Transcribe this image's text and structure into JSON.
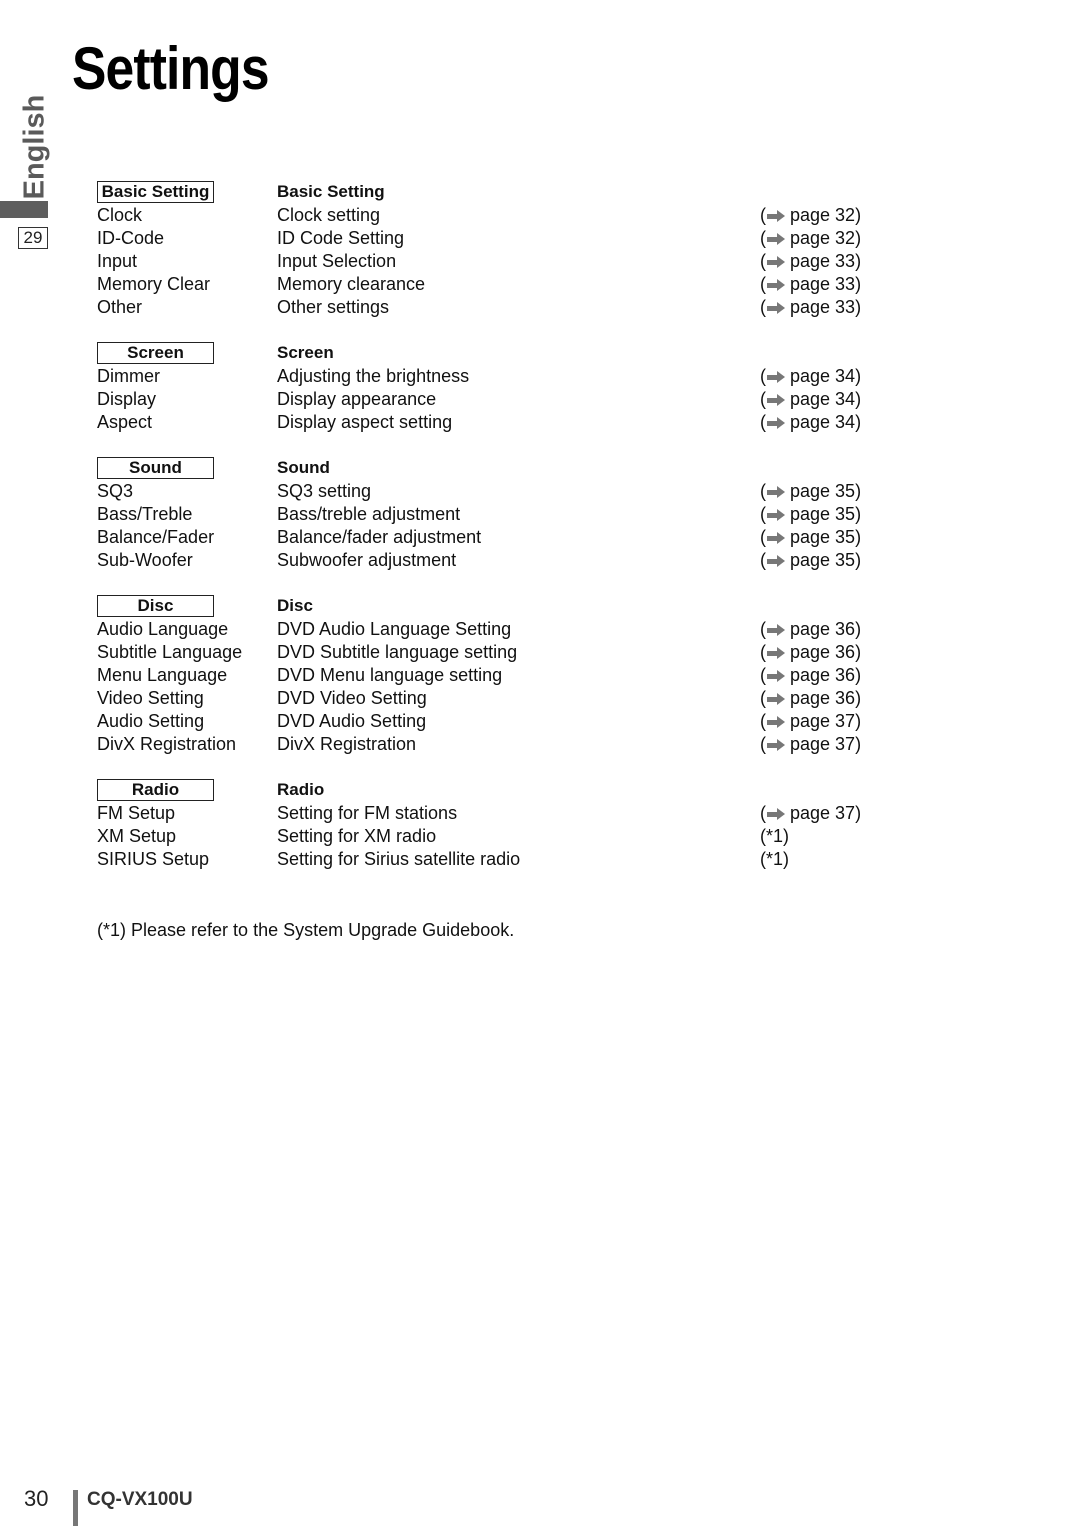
{
  "page": {
    "title": "Settings",
    "language_tab": "English",
    "section_page_number": "29",
    "page_number": "30",
    "model": "CQ-VX100U",
    "footnote": "(*1) Please refer to the System Upgrade Guidebook."
  },
  "sections": [
    {
      "box_label": "Basic Setting",
      "heading": "Basic Setting",
      "items": [
        {
          "name": "Clock",
          "description": "Clock setting",
          "ref": "page 32",
          "icon": "arrow-right-icon"
        },
        {
          "name": "ID-Code",
          "description": "ID Code Setting",
          "ref": "page 32",
          "icon": "arrow-right-icon"
        },
        {
          "name": "Input",
          "description": "Input Selection",
          "ref": "page 33",
          "icon": "arrow-right-icon"
        },
        {
          "name": "Memory Clear",
          "description": "Memory clearance",
          "ref": "page 33",
          "icon": "arrow-right-icon"
        },
        {
          "name": "Other",
          "description": "Other settings",
          "ref": "page 33",
          "icon": "arrow-right-icon"
        }
      ]
    },
    {
      "box_label": "Screen",
      "heading": "Screen",
      "items": [
        {
          "name": "Dimmer",
          "description": "Adjusting the brightness",
          "ref": "page 34",
          "icon": "arrow-right-icon"
        },
        {
          "name": "Display",
          "description": "Display appearance",
          "ref": "page 34",
          "icon": "arrow-right-icon"
        },
        {
          "name": "Aspect",
          "description": "Display aspect setting",
          "ref": "page 34",
          "icon": "arrow-right-icon"
        }
      ]
    },
    {
      "box_label": "Sound",
      "heading": "Sound",
      "items": [
        {
          "name": "SQ3",
          "description": "SQ3 setting",
          "ref": "page 35",
          "icon": "arrow-right-icon"
        },
        {
          "name": "Bass/Treble",
          "description": "Bass/treble adjustment",
          "ref": "page 35",
          "icon": "arrow-right-icon"
        },
        {
          "name": "Balance/Fader",
          "description": "Balance/fader adjustment",
          "ref": "page 35",
          "icon": "arrow-right-icon"
        },
        {
          "name": "Sub-Woofer",
          "description": "Subwoofer adjustment",
          "ref": "page 35",
          "icon": "arrow-right-icon"
        }
      ]
    },
    {
      "box_label": "Disc",
      "heading": "Disc",
      "items": [
        {
          "name": "Audio Language",
          "description": "DVD Audio Language Setting",
          "ref": "page 36",
          "icon": "arrow-right-icon"
        },
        {
          "name": "Subtitle Language",
          "description": "DVD Subtitle language setting",
          "ref": "page 36",
          "icon": "arrow-right-icon"
        },
        {
          "name": "Menu Language",
          "description": "DVD Menu language setting",
          "ref": "page 36",
          "icon": "arrow-right-icon"
        },
        {
          "name": "Video Setting",
          "description": "DVD Video Setting",
          "ref": "page 36",
          "icon": "arrow-right-icon"
        },
        {
          "name": "Audio Setting",
          "description": "DVD Audio Setting",
          "ref": "page 37",
          "icon": "arrow-right-icon"
        },
        {
          "name": "DivX Registration",
          "description": "DivX Registration",
          "ref": "page 37",
          "icon": "arrow-right-icon"
        }
      ]
    },
    {
      "box_label": "Radio",
      "heading": "Radio",
      "items": [
        {
          "name": "FM Setup",
          "description": "Setting for FM stations",
          "ref": "page 37",
          "icon": "arrow-right-icon"
        },
        {
          "name": "XM Setup",
          "description": "Setting for XM radio",
          "ref": "*1",
          "icon": null
        },
        {
          "name": "SIRIUS Setup",
          "description": "Setting for Sirius satellite radio",
          "ref": "*1",
          "icon": null
        }
      ]
    }
  ]
}
